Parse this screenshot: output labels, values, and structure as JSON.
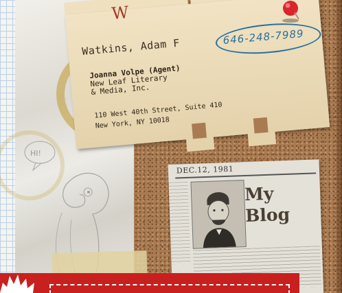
{
  "card": {
    "letter": "W",
    "name": "Watkins, Adam F",
    "phone": "646-248-7989",
    "agent_line1": "Joanna Volpe (Agent)",
    "agent_line2": "New Leaf Literary",
    "agent_line3": "& Media, Inc.",
    "address_line1": "110 West 40th Street, Suite 410",
    "address_line2": "New York, NY 10018"
  },
  "sketch": {
    "bubble_text": "HI!"
  },
  "newspaper": {
    "date": "DEC.12, 1981",
    "headline_line1": "My",
    "headline_line2": "Blog"
  },
  "colors": {
    "cork": "#a97b52",
    "card": "#ecdcb9",
    "letter": "#a33a26",
    "phone_ink": "#2a6f9e",
    "banner_red": "#c8201e",
    "pin_red": "#d9262b"
  },
  "icons": {
    "pushpin": "pushpin-icon",
    "parrot_sketch": "parrot-sketch-icon"
  }
}
